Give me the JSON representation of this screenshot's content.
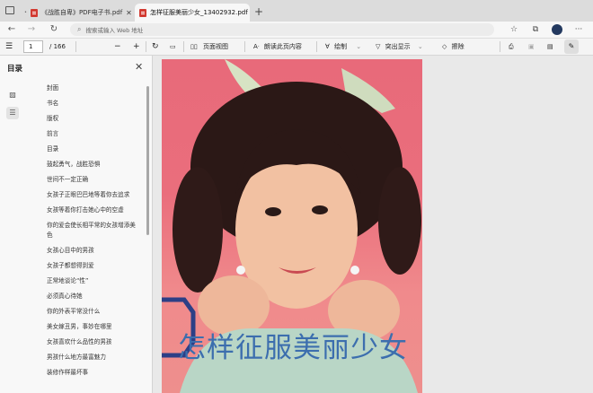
{
  "tabs": [
    {
      "title": "《战胜自卑》PDF电子书.pdf",
      "active": false
    },
    {
      "title": "怎样征服美丽少女_13402932.pdf",
      "active": true
    }
  ],
  "address": {
    "placeholder": "搜索或输入 Web 地址"
  },
  "pdf_toolbar": {
    "page_current": "1",
    "page_total": "/ 166",
    "page_view": "页面视图",
    "read_aloud": "朗读此页内容",
    "draw": "绘制",
    "highlight": "突出显示",
    "erase": "擦除"
  },
  "sidebar": {
    "title": "目录",
    "items": [
      "封面",
      "书名",
      "版权",
      "前言",
      "目录",
      "鼓起勇气，战胜恐惧",
      "世间不一定正确",
      "女孩子正眼巴巴地等着你去追求",
      "女孩等着你打击她心中的空虚",
      "你的爱会使长相平常的女孩增添美色",
      "女孩心目中的男孩",
      "女孩子都想得到爱",
      "正常地谈论“性”",
      "必须真心待她",
      "你的外表平常没什么",
      "美女嫁丑男，事妙在哪里",
      "女孩喜欢什么品性的男孩",
      "男孩什么地方最富魅力",
      "装修作样最坏事"
    ]
  },
  "cover": {
    "title": "怎样征服美丽少女"
  },
  "colors": {
    "tabbar": "#dcdcdc",
    "toolbar": "#f4f4f4",
    "cover_bg": "#e86a7a",
    "title_text": "#3c6eae",
    "pdf_icon": "#d23a31"
  }
}
